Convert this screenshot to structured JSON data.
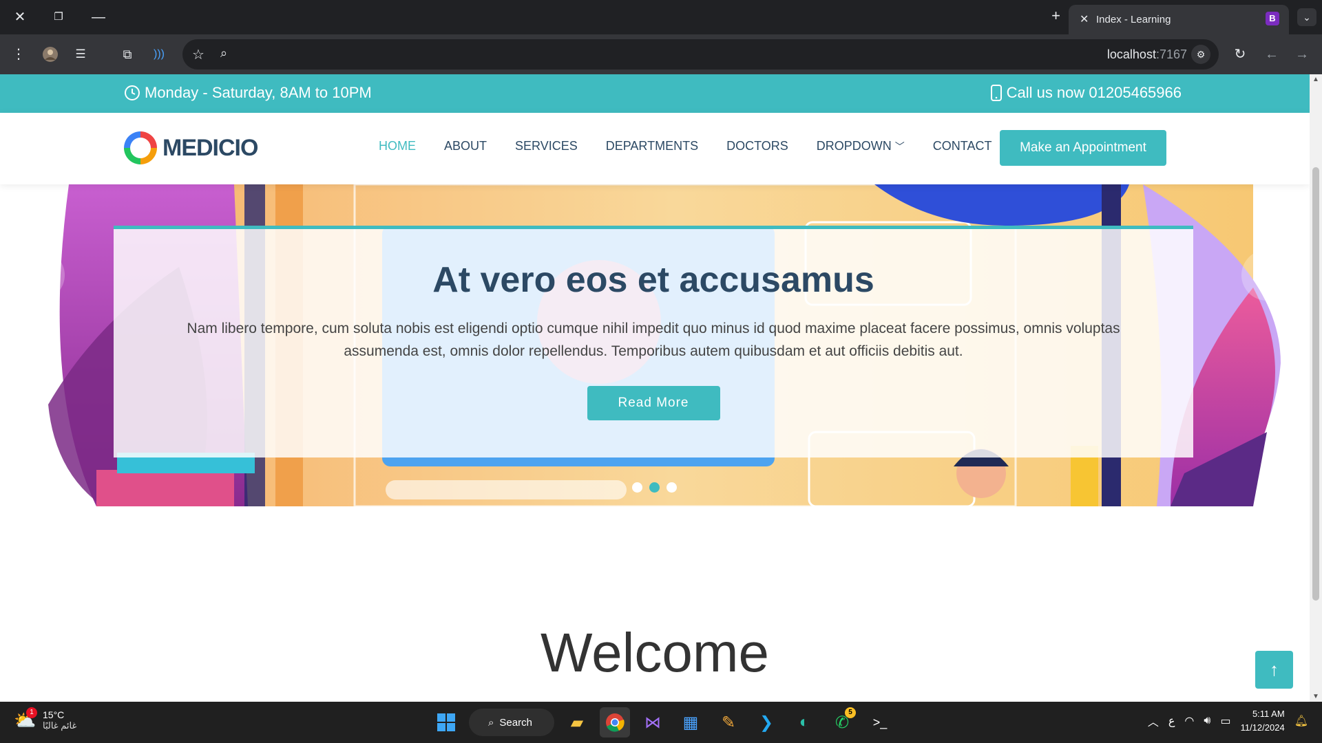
{
  "browser": {
    "tab_title": "Index - Learning",
    "tab_favicon": "B",
    "url_host": "localhost",
    "url_port": ":7167"
  },
  "topbar": {
    "hours": "Monday - Saturday, 8AM to 10PM",
    "phone": "Call us now 01205465966"
  },
  "header": {
    "logo": "MEDICIO",
    "nav": [
      "HOME",
      "ABOUT",
      "SERVICES",
      "DEPARTMENTS",
      "DOCTORS",
      "DROPDOWN",
      "CONTACT"
    ],
    "active_nav": "HOME",
    "cta": "Make an Appointment"
  },
  "hero": {
    "title": "At vero eos et accusamus",
    "text": "Nam libero tempore, cum soluta nobis est eligendi optio cumque nihil impedit quo minus id quod maxime placeat facere possimus, omnis voluptas assumenda est, omnis dolor repellendus. Temporibus autem quibusdam et aut officiis debitis aut.",
    "button": "Read More",
    "slides": 3,
    "active_slide": 2
  },
  "welcome": {
    "title": "Welcome"
  },
  "colors": {
    "accent": "#3fbbc0",
    "heading": "#2c4964"
  },
  "taskbar": {
    "temperature": "15°C",
    "condition": "غائم غالبًا",
    "weather_badge": "1",
    "search": "Search",
    "whatsapp_badge": "5",
    "language": "ع",
    "time": "5:11 AM",
    "date": "11/12/2024"
  }
}
